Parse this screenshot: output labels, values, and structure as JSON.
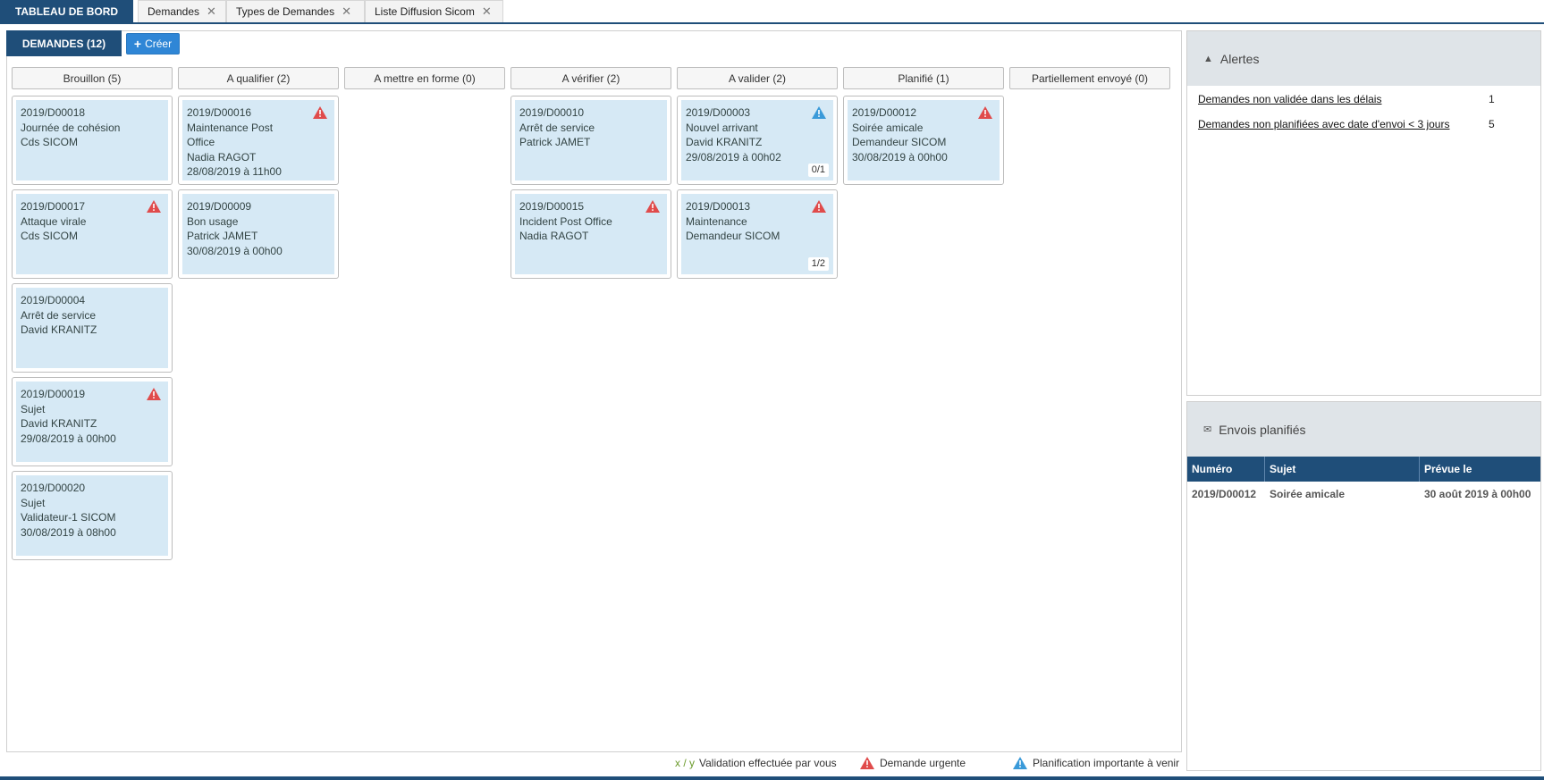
{
  "tabs": [
    {
      "label": "TABLEAU DE BORD",
      "active": true,
      "closable": false
    },
    {
      "label": "Demandes",
      "active": false,
      "closable": true
    },
    {
      "label": "Types de Demandes",
      "active": false,
      "closable": true
    },
    {
      "label": "Liste Diffusion Sicom",
      "active": false,
      "closable": true
    }
  ],
  "board": {
    "title": "DEMANDES (12)",
    "create_label": "Créer"
  },
  "columns": [
    {
      "title": "Brouillon (5)",
      "cards": [
        {
          "id": "2019/D00018",
          "lines": [
            "Journée de cohésion",
            "Cds SICOM"
          ],
          "icon": "",
          "count": ""
        },
        {
          "id": "2019/D00017",
          "lines": [
            "Attaque virale",
            "Cds SICOM"
          ],
          "icon": "urgent",
          "count": ""
        },
        {
          "id": "2019/D00004",
          "lines": [
            "Arrêt de service",
            "David KRANITZ"
          ],
          "icon": "",
          "count": ""
        },
        {
          "id": "2019/D00019",
          "lines": [
            "Sujet",
            "David KRANITZ",
            "29/08/2019 à 00h00"
          ],
          "icon": "urgent",
          "count": ""
        },
        {
          "id": "2019/D00020",
          "lines": [
            "Sujet",
            "Validateur-1 SICOM",
            "30/08/2019 à 08h00"
          ],
          "icon": "",
          "count": ""
        }
      ]
    },
    {
      "title": "A qualifier (2)",
      "cards": [
        {
          "id": "2019/D00016",
          "lines": [
            "Maintenance Post",
            "Office",
            "Nadia RAGOT",
            "28/08/2019 à 11h00"
          ],
          "icon": "urgent",
          "count": ""
        },
        {
          "id": "2019/D00009",
          "lines": [
            "Bon usage",
            "Patrick JAMET",
            "30/08/2019 à 00h00"
          ],
          "icon": "",
          "count": ""
        }
      ]
    },
    {
      "title": "A mettre en forme (0)",
      "cards": []
    },
    {
      "title": "A vérifier (2)",
      "cards": [
        {
          "id": "2019/D00010",
          "lines": [
            "Arrêt de service",
            "Patrick JAMET"
          ],
          "icon": "",
          "count": ""
        },
        {
          "id": "2019/D00015",
          "lines": [
            "Incident Post Office",
            "Nadia RAGOT"
          ],
          "icon": "urgent",
          "count": ""
        }
      ]
    },
    {
      "title": "A valider (2)",
      "cards": [
        {
          "id": "2019/D00003",
          "lines": [
            "Nouvel arrivant",
            "David KRANITZ",
            "29/08/2019 à 00h02"
          ],
          "icon": "planif",
          "count": "0/1"
        },
        {
          "id": "2019/D00013",
          "lines": [
            "Maintenance",
            "Demandeur SICOM"
          ],
          "icon": "urgent",
          "count": "1/2"
        }
      ]
    },
    {
      "title": "Planifié (1)",
      "cards": [
        {
          "id": "2019/D00012",
          "lines": [
            "Soirée amicale",
            "Demandeur SICOM",
            "30/08/2019 à 00h00"
          ],
          "icon": "urgent",
          "count": ""
        }
      ]
    },
    {
      "title": "Partiellement envoyé (0)",
      "cards": []
    }
  ],
  "legend": {
    "xy": "x / y",
    "validation": "Validation effectuée par vous",
    "urgent": "Demande urgente",
    "planif": "Planification importante à venir"
  },
  "colors": {
    "urgent": "#e04b4b",
    "planif": "#3a9ad9",
    "primary": "#1f4e79"
  },
  "alerts": {
    "title": "Alertes",
    "items": [
      {
        "label": "Demandes non validée dans les délais",
        "value": "1"
      },
      {
        "label": "Demandes non planifiées avec date d'envoi < 3 jours",
        "value": "5"
      }
    ]
  },
  "envois": {
    "title": "Envois planifiés",
    "headers": [
      "Numéro",
      "Sujet",
      "Prévue le"
    ],
    "rows": [
      [
        "2019/D00012",
        "Soirée amicale",
        "30 août 2019 à 00h00"
      ]
    ]
  }
}
